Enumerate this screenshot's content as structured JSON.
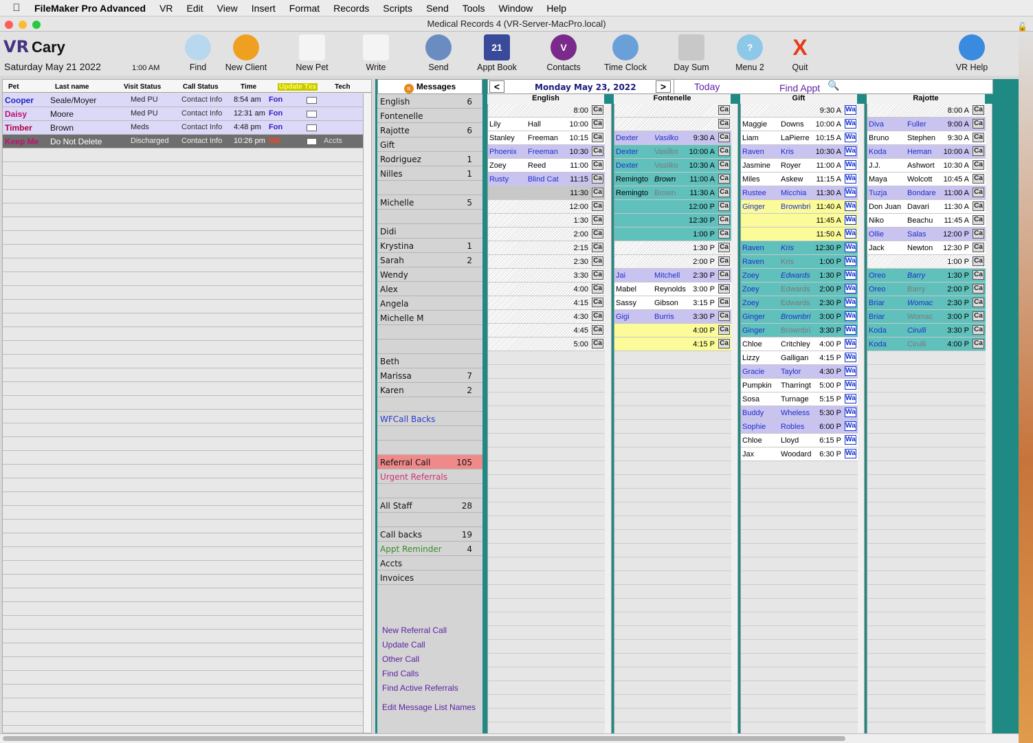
{
  "menubar": {
    "app": "FileMaker Pro Advanced",
    "items": [
      "VR",
      "Edit",
      "View",
      "Insert",
      "Format",
      "Records",
      "Scripts",
      "Send",
      "Tools",
      "Window",
      "Help"
    ]
  },
  "window": {
    "title": "Medical Records 4 (VR-Server-MacPro.local)"
  },
  "header": {
    "logo": "VR",
    "user": "Cary",
    "date": "Saturday May 21 2022",
    "time": "1:00 AM"
  },
  "toolbar": [
    {
      "label": "Find",
      "icon": "magnifier-icon"
    },
    {
      "label": "New Client",
      "icon": "walking-person-icon"
    },
    {
      "label": "New Pet",
      "icon": "dog-icon"
    },
    {
      "label": "Write",
      "icon": "document-icon"
    },
    {
      "label": "Send",
      "icon": "eagle-icon"
    },
    {
      "label": "Appt Book",
      "icon": "calendar-icon",
      "badge": "21"
    },
    {
      "label": "Contacts",
      "icon": "contacts-icon",
      "badge": "V"
    },
    {
      "label": "Time Clock",
      "icon": "clock-icon"
    },
    {
      "label": "Day Sum",
      "icon": "building-icon"
    },
    {
      "label": "Menu 2",
      "icon": "help-icon",
      "badge": "?"
    },
    {
      "label": "Quit",
      "icon": "close-icon",
      "badge": "X"
    },
    {
      "label": "VR Help",
      "icon": "vr-help-icon"
    }
  ],
  "colors": {
    "teal": "#1f8a84",
    "lavender": "#c9c3f0",
    "appt_teal": "#5fc0bc",
    "yellow": "#fbfb9a",
    "blue_text": "#2030c8",
    "purple": "#5a1fa3"
  },
  "patients": {
    "headers": {
      "pet": "Pet",
      "last": "Last name",
      "visit": "Visit Status",
      "call": "Call Status",
      "time": "Time",
      "update": "Update Txs",
      "tech": "Tech"
    },
    "rows": [
      {
        "pet": "Cooper",
        "last": "Seale/Moyer",
        "visit": "Med PU",
        "call": "Contact Info",
        "time": "8:54 am",
        "tech": "Fon",
        "extra": ""
      },
      {
        "pet": "Daisy",
        "last": "Moore",
        "visit": "Med PU",
        "call": "Contact Info",
        "time": "12:31 am",
        "tech": "Fon",
        "extra": ""
      },
      {
        "pet": "Timber",
        "last": "Brown",
        "visit": "Meds",
        "call": "Contact Info",
        "time": "4:48 pm",
        "tech": "Fon",
        "extra": ""
      },
      {
        "pet": "Keep Me",
        "last": "Do Not Delete",
        "visit": "Discharged",
        "call": "Contact Info",
        "time": "10:26 pm",
        "tech": "Nill",
        "extra": "Accts"
      }
    ]
  },
  "messages": {
    "title": "Messages",
    "rows": [
      {
        "label": "English",
        "count": "6"
      },
      {
        "label": "Fontenelle",
        "count": ""
      },
      {
        "label": "Rajotte",
        "count": "6"
      },
      {
        "label": "Gift",
        "count": ""
      },
      {
        "label": "Rodriguez",
        "count": "1"
      },
      {
        "label": "Nilles",
        "count": "1"
      },
      {
        "label": "",
        "count": ""
      },
      {
        "label": "Michelle",
        "count": "5"
      },
      {
        "label": "",
        "count": ""
      },
      {
        "label": "Didi",
        "count": ""
      },
      {
        "label": "Krystina",
        "count": "1"
      },
      {
        "label": "Sarah",
        "count": "2"
      },
      {
        "label": "Wendy",
        "count": ""
      },
      {
        "label": "Alex",
        "count": ""
      },
      {
        "label": "Angela",
        "count": ""
      },
      {
        "label": "Michelle M",
        "count": ""
      },
      {
        "label": "",
        "count": ""
      },
      {
        "label": "",
        "count": ""
      },
      {
        "label": "Beth",
        "count": ""
      },
      {
        "label": "Marissa",
        "count": "7"
      },
      {
        "label": "Karen",
        "count": "2"
      },
      {
        "label": "",
        "count": ""
      },
      {
        "label": "WFCall Backs",
        "count": "",
        "style": "blue"
      },
      {
        "label": "",
        "count": ""
      },
      {
        "label": "",
        "count": ""
      },
      {
        "label": "Referral Call",
        "count": "105",
        "style": "referral"
      },
      {
        "label": "Urgent Referrals",
        "count": "",
        "style": "urgent"
      },
      {
        "label": "",
        "count": ""
      },
      {
        "label": "All Staff",
        "count": "28"
      },
      {
        "label": "",
        "count": ""
      },
      {
        "label": "Call backs",
        "count": "19"
      },
      {
        "label": "Appt Reminder",
        "count": "4",
        "style": "green"
      },
      {
        "label": "Accts",
        "count": ""
      },
      {
        "label": "Invoices",
        "count": ""
      }
    ],
    "actions": [
      "New Referral Call",
      "Update Call",
      "Other Call",
      "Find Calls",
      "Find Active Referrals",
      "Edit Message List Names"
    ]
  },
  "schedule": {
    "date": "Monday May 23, 2022",
    "today": "Today",
    "find": "Find Appt",
    "prev": "<",
    "next": ">",
    "columns": [
      {
        "name": "English",
        "btn": "Ca",
        "slots": [
          {
            "t": "8:00",
            "s": "empty"
          },
          {
            "p": "Lily",
            "o": "Hall",
            "t": "10:00",
            "s": "none"
          },
          {
            "p": "Stanley",
            "o": "Freeman",
            "t": "10:15",
            "s": "none"
          },
          {
            "p": "Phoenix",
            "o": "Freeman",
            "t": "10:30",
            "s": "lav",
            "c": "blu"
          },
          {
            "p": "Zoey",
            "o": "Reed",
            "t": "11:00",
            "s": "none"
          },
          {
            "p": "Rusty",
            "o": "Blind Cat",
            "t": "11:15",
            "s": "lav",
            "c": "blu"
          },
          {
            "t": "11:30",
            "s": "grey"
          },
          {
            "t": "12:00",
            "s": "empty"
          },
          {
            "t": "1:30",
            "s": "empty"
          },
          {
            "t": "2:00",
            "s": "empty"
          },
          {
            "t": "2:15",
            "s": "empty"
          },
          {
            "t": "2:30",
            "s": "empty"
          },
          {
            "t": "3:30",
            "s": "empty"
          },
          {
            "t": "4:00",
            "s": "empty"
          },
          {
            "t": "4:15",
            "s": "empty"
          },
          {
            "t": "4:30",
            "s": "empty"
          },
          {
            "t": "4:45",
            "s": "empty"
          },
          {
            "t": "5:00",
            "s": "empty"
          }
        ]
      },
      {
        "name": "Fontenelle",
        "btn": "Ca",
        "slots": [
          {
            "t": "",
            "s": "empty"
          },
          {
            "t": "",
            "s": "empty"
          },
          {
            "p": "Dexter",
            "o": "Vasilko",
            "t": "9:30 A",
            "s": "lav",
            "c": "blu",
            "oi": true
          },
          {
            "p": "Dexter",
            "o": "Vasilko",
            "t": "10:00 A",
            "s": "teal",
            "c": "blu",
            "og": true
          },
          {
            "p": "Dexter",
            "o": "Vasilko",
            "t": "10:30 A",
            "s": "teal",
            "c": "blu",
            "og": true
          },
          {
            "p": "Remingto",
            "o": "Brown",
            "t": "11:00 A",
            "s": "teal",
            "oi": true
          },
          {
            "p": "Remingto",
            "o": "Brown",
            "t": "11:30 A",
            "s": "teal",
            "og": true
          },
          {
            "t": "12:00 P",
            "s": "teal"
          },
          {
            "t": "12:30 P",
            "s": "teal"
          },
          {
            "t": "1:00 P",
            "s": "teal"
          },
          {
            "t": "1:30 P",
            "s": "empty"
          },
          {
            "t": "2:00 P",
            "s": "empty"
          },
          {
            "p": "Jai",
            "o": "Mitchell",
            "t": "2:30 P",
            "s": "lav",
            "c": "blu"
          },
          {
            "p": "Mabel",
            "o": "Reynolds",
            "t": "3:00 P",
            "s": "none"
          },
          {
            "p": "Sassy",
            "o": "Gibson",
            "t": "3:15 P",
            "s": "none"
          },
          {
            "p": "Gigi",
            "o": "Burris",
            "t": "3:30 P",
            "s": "lav",
            "c": "blu"
          },
          {
            "t": "4:00 P",
            "s": "yel"
          },
          {
            "t": "4:15 P",
            "s": "yel"
          }
        ]
      },
      {
        "name": "Gift",
        "btn": "Wa",
        "slots": [
          {
            "t": "9:30 A",
            "s": "empty"
          },
          {
            "p": "Maggie",
            "o": "Downs",
            "t": "10:00 A",
            "s": "none"
          },
          {
            "p": "Liam",
            "o": "LaPierre",
            "t": "10:15 A",
            "s": "none"
          },
          {
            "p": "Raven",
            "o": "Kris",
            "t": "10:30 A",
            "s": "lav",
            "c": "blu"
          },
          {
            "p": "Jasmine",
            "o": "Royer",
            "t": "11:00 A",
            "s": "none"
          },
          {
            "p": "Miles",
            "o": "Askew",
            "t": "11:15 A",
            "s": "none"
          },
          {
            "p": "Rustee",
            "o": "Micchia",
            "t": "11:30 A",
            "s": "lav",
            "c": "blu"
          },
          {
            "p": "Ginger",
            "o": "Brownbri",
            "t": "11:40 A",
            "s": "yel",
            "c": "blu"
          },
          {
            "t": "11:45 A",
            "s": "yel"
          },
          {
            "t": "11:50 A",
            "s": "yel"
          },
          {
            "p": "Raven",
            "o": "Kris",
            "t": "12:30 P",
            "s": "teal",
            "c": "blu",
            "oi": true
          },
          {
            "p": "Raven",
            "o": "Kris",
            "t": "1:00 P",
            "s": "teal",
            "c": "blu",
            "og": true
          },
          {
            "p": "Zoey",
            "o": "Edwards",
            "t": "1:30 P",
            "s": "teal",
            "c": "blu",
            "oi": true
          },
          {
            "p": "Zoey",
            "o": "Edwards",
            "t": "2:00 P",
            "s": "teal",
            "c": "blu",
            "og": true
          },
          {
            "p": "Zoey",
            "o": "Edwards",
            "t": "2:30 P",
            "s": "teal",
            "c": "blu",
            "og": true
          },
          {
            "p": "Ginger",
            "o": "Brownbri",
            "t": "3:00 P",
            "s": "teal",
            "c": "blu",
            "oi": true
          },
          {
            "p": "Ginger",
            "o": "Brownbri",
            "t": "3:30 P",
            "s": "teal",
            "c": "blu",
            "og": true
          },
          {
            "p": "Chloe",
            "o": "Critchley",
            "t": "4:00 P",
            "s": "none"
          },
          {
            "p": "Lizzy",
            "o": "Galligan",
            "t": "4:15 P",
            "s": "none"
          },
          {
            "p": "Gracie",
            "o": "Taylor",
            "t": "4:30 P",
            "s": "lav",
            "c": "blu"
          },
          {
            "p": "Pumpkin",
            "o": "Tharringt",
            "t": "5:00 P",
            "s": "none"
          },
          {
            "p": "Sosa",
            "o": "Turnage",
            "t": "5:15 P",
            "s": "none"
          },
          {
            "p": "Buddy",
            "o": "Wheless",
            "t": "5:30 P",
            "s": "lav",
            "c": "blu"
          },
          {
            "p": "Sophie",
            "o": "Robles",
            "t": "6:00 P",
            "s": "lav",
            "c": "blu"
          },
          {
            "p": "Chloe",
            "o": "Lloyd",
            "t": "6:15 P",
            "s": "none"
          },
          {
            "p": "Jax",
            "o": "Woodard",
            "t": "6:30 P",
            "s": "none"
          }
        ]
      },
      {
        "name": "Rajotte",
        "btn": "Ca",
        "slots": [
          {
            "t": "8:00 A",
            "s": "empty"
          },
          {
            "p": "Diva",
            "o": "Fuller",
            "t": "9:00 A",
            "s": "lav",
            "c": "blu"
          },
          {
            "p": "Bruno",
            "o": "Stephen",
            "t": "9:30 A",
            "s": "none"
          },
          {
            "p": "Koda",
            "o": "Heman",
            "t": "10:00 A",
            "s": "lav",
            "c": "blu"
          },
          {
            "p": "J.J.",
            "o": "Ashwort",
            "t": "10:30 A",
            "s": "none"
          },
          {
            "p": "Maya",
            "o": "Wolcott",
            "t": "10:45 A",
            "s": "none"
          },
          {
            "p": "Tuzja",
            "o": "Bondare",
            "t": "11:00 A",
            "s": "lav",
            "c": "blu"
          },
          {
            "p": "Don Juan",
            "o": "Davari",
            "t": "11:30 A",
            "s": "none"
          },
          {
            "p": "Niko",
            "o": "Beachu",
            "t": "11:45 A",
            "s": "none"
          },
          {
            "p": "Ollie",
            "o": "Salas",
            "t": "12:00 P",
            "s": "lav",
            "c": "blu"
          },
          {
            "p": "Jack",
            "o": "Newton",
            "t": "12:30 P",
            "s": "none"
          },
          {
            "t": "1:00 P",
            "s": "empty"
          },
          {
            "p": "Oreo",
            "o": "Barry",
            "t": "1:30 P",
            "s": "teal",
            "c": "blu",
            "oi": true
          },
          {
            "p": "Oreo",
            "o": "Barry",
            "t": "2:00 P",
            "s": "teal",
            "c": "blu",
            "og": true
          },
          {
            "p": "Briar",
            "o": "Womac",
            "t": "2:30 P",
            "s": "teal",
            "c": "blu",
            "oi": true
          },
          {
            "p": "Briar",
            "o": "Womac",
            "t": "3:00 P",
            "s": "teal",
            "c": "blu",
            "og": true
          },
          {
            "p": "Koda",
            "o": "Cirulli",
            "t": "3:30 P",
            "s": "teal",
            "c": "blu",
            "oi": true
          },
          {
            "p": "Koda",
            "o": "Cirulli",
            "t": "4:00 P",
            "s": "teal",
            "c": "blu",
            "og": true
          }
        ]
      }
    ]
  }
}
